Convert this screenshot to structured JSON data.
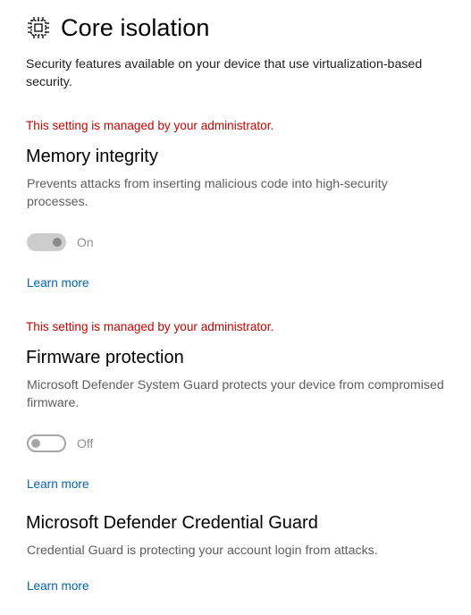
{
  "header": {
    "icon": "core-isolation-chip-icon",
    "title": "Core isolation"
  },
  "intro": "Security features available on your device that use virtualization-based security.",
  "memory_integrity": {
    "admin_note": "This setting is managed by your administrator.",
    "title": "Memory integrity",
    "description": "Prevents attacks from inserting malicious code into high-security processes.",
    "toggle_state": "On",
    "enabled": false,
    "learn_more": "Learn more"
  },
  "firmware_protection": {
    "admin_note": "This setting is managed by your administrator.",
    "title": "Firmware protection",
    "description": "Microsoft Defender System Guard protects your device from compromised firmware.",
    "toggle_state": "Off",
    "enabled": false,
    "learn_more": "Learn more"
  },
  "credential_guard": {
    "title": "Microsoft Defender Credential Guard",
    "description": "Credential Guard is protecting your account login from attacks.",
    "learn_more": "Learn more"
  },
  "colors": {
    "admin_note": "#c50500",
    "link": "#0063b1",
    "secondary_text": "#5e5e5e"
  }
}
